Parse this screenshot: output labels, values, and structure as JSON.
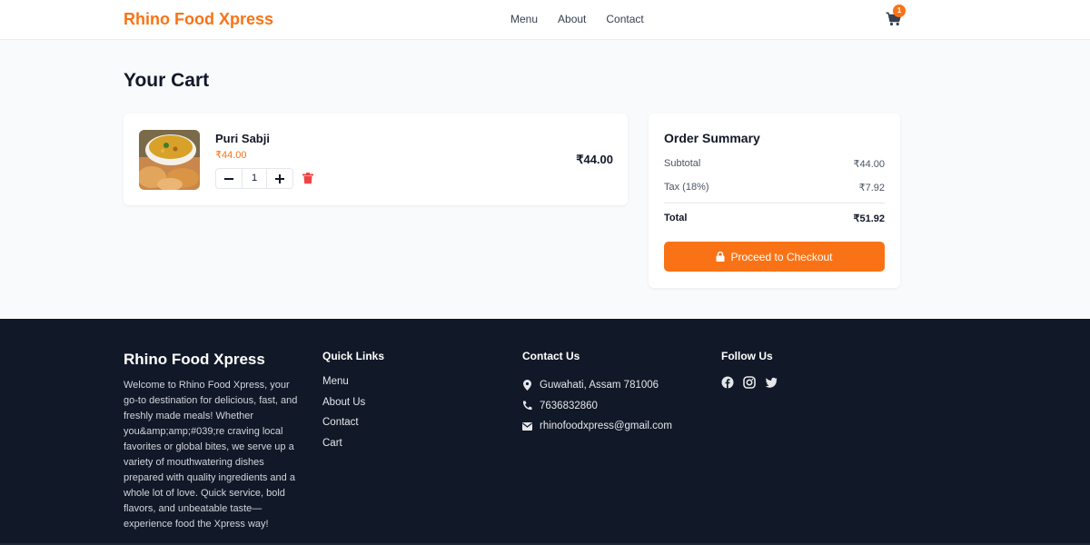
{
  "header": {
    "brand": "Rhino Food Xpress",
    "nav": [
      "Menu",
      "About",
      "Contact"
    ],
    "cart_count": "1",
    "cart_icon": "shopping-cart-icon"
  },
  "main": {
    "title": "Your Cart",
    "cart_items": [
      {
        "name": "Puri Sabji",
        "price": "₹44.00",
        "quantity": "1",
        "line_total": "₹44.00"
      }
    ]
  },
  "summary": {
    "title": "Order Summary",
    "subtotal_label": "Subtotal",
    "subtotal_value": "₹44.00",
    "tax_label": "Tax (18%)",
    "tax_value": "₹7.92",
    "total_label": "Total",
    "total_value": "₹51.92",
    "checkout_label": "Proceed to Checkout"
  },
  "footer": {
    "brand": "Rhino Food Xpress",
    "description": "Welcome to Rhino Food Xpress, your go-to destination for delicious, fast, and freshly made meals! Whether you&amp;amp;#039;re craving local favorites or global bites, we serve up a variety of mouthwatering dishes prepared with quality ingredients and a whole lot of love. Quick service, bold flavors, and unbeatable taste—experience food the Xpress way!",
    "quick_links_title": "Quick Links",
    "quick_links": [
      "Menu",
      "About Us",
      "Contact",
      "Cart"
    ],
    "contact_title": "Contact Us",
    "address": "Guwahati, Assam 781006",
    "phone": "7636832860",
    "email": "rhinofoodxpress@gmail.com",
    "follow_title": "Follow Us",
    "social_icons": [
      "facebook-icon",
      "instagram-icon",
      "twitter-icon"
    ]
  },
  "colors": {
    "accent": "#f97316",
    "footer_bg": "#111827",
    "page_bg": "#f9fafb",
    "delete": "#ef4444"
  }
}
